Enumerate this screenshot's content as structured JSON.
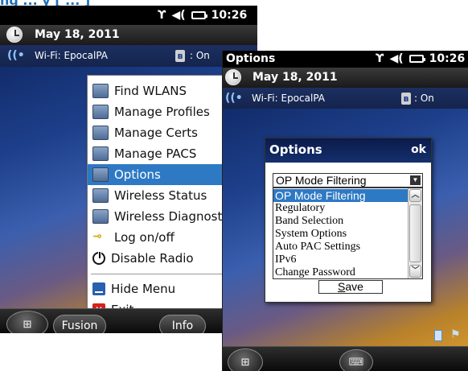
{
  "heading": "ng ... y [ ... ]",
  "left_screen": {
    "status": {
      "time": "10:26"
    },
    "today": {
      "date": "May 18, 2011",
      "wifi": "Wi-Fi: EpocalPA",
      "bt_status": ": On"
    },
    "menu": {
      "items": [
        {
          "label": "Find WLANS",
          "icon": "find-wlans-icon"
        },
        {
          "label": "Manage Profiles",
          "icon": "manage-profiles-icon"
        },
        {
          "label": "Manage Certs",
          "icon": "manage-certs-icon"
        },
        {
          "label": "Manage PACS",
          "icon": "manage-pacs-icon"
        },
        {
          "label": "Options",
          "icon": "options-icon",
          "selected": true
        },
        {
          "label": "Wireless Status",
          "icon": "wireless-status-icon"
        },
        {
          "label": "Wireless Diagnostics",
          "icon": "wireless-diagnostics-icon"
        },
        {
          "label": "Log on/off",
          "icon": "key-icon"
        },
        {
          "label": "Disable Radio",
          "icon": "power-icon"
        },
        {
          "label": "Hide Menu",
          "icon": "hide-menu-icon"
        },
        {
          "label": "Exit",
          "icon": "exit-icon"
        }
      ]
    },
    "softkeys": {
      "left": "Fusion",
      "right": "Info"
    }
  },
  "right_screen": {
    "title": "Options",
    "status": {
      "time": "10:26"
    },
    "today": {
      "date": "May 18, 2011",
      "wifi": "Wi-Fi: EpocalPA",
      "bt_status": ": On"
    },
    "dialog": {
      "title": "Options",
      "ok": "ok",
      "selected_value": "OP Mode Filtering",
      "options": [
        "OP Mode Filtering",
        "Regulatory",
        "Band Selection",
        "System Options",
        "Auto PAC Settings",
        "IPv6",
        "Change Password"
      ],
      "save_label_u": "S",
      "save_label_rest": "ave"
    }
  },
  "colors": {
    "selection": "#2e79c4",
    "dialog_header": "#0b1a4a",
    "heading": "#1f6fb9"
  }
}
